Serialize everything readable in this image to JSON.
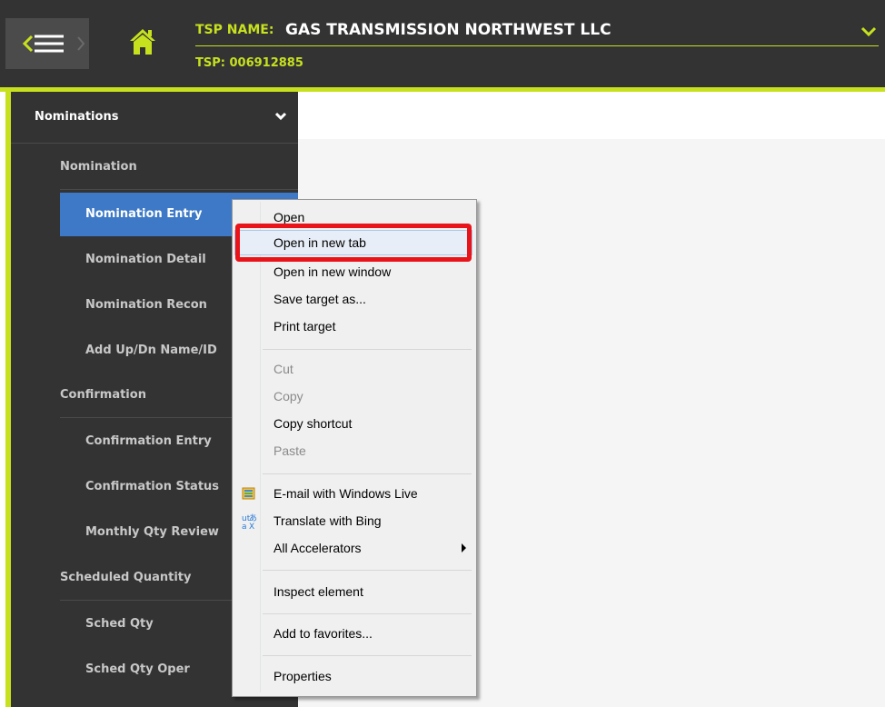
{
  "header": {
    "tsp_name_prefix": "TSP NAME:",
    "tsp_name": "GAS TRANSMISSION NORTHWEST LLC",
    "tsp_id": "TSP: 006912885",
    "accent_color": "#c7e11f",
    "icons": [
      "menu-toggle-icon",
      "home-icon",
      "chevron-down-icon"
    ]
  },
  "sidebar": {
    "group_title": "Nominations",
    "sections": [
      {
        "label": "Nomination",
        "items": [
          "Nomination Entry",
          "Nomination Detail",
          "Nomination Recon",
          "Add Up/Dn Name/ID"
        ]
      },
      {
        "label": "Confirmation",
        "items": [
          "Confirmation Entry",
          "Confirmation Status",
          "Monthly Qty Review"
        ]
      },
      {
        "label": "Scheduled Quantity",
        "items": [
          "Sched Qty",
          "Sched Qty Oper"
        ]
      }
    ],
    "active_item": "Nomination Entry",
    "active_color": "#3d79c6"
  },
  "context_menu": {
    "items": [
      {
        "label": "Open",
        "enabled": true
      },
      {
        "label": "Open in new tab",
        "enabled": true,
        "hovered": true,
        "highlighted": true
      },
      {
        "label": "Open in new window",
        "enabled": true
      },
      {
        "label": "Save target as...",
        "enabled": true
      },
      {
        "label": "Print target",
        "enabled": true
      },
      {
        "label": "Cut",
        "enabled": false
      },
      {
        "label": "Copy",
        "enabled": false
      },
      {
        "label": "Copy shortcut",
        "enabled": true
      },
      {
        "label": "Paste",
        "enabled": false
      },
      {
        "label": "E-mail with Windows Live",
        "enabled": true,
        "icon": "windows-live-mail-icon"
      },
      {
        "label": "Translate with Bing",
        "enabled": true,
        "icon": "bing-translate-icon"
      },
      {
        "label": "All Accelerators",
        "enabled": true,
        "submenu": true
      },
      {
        "label": "Inspect element",
        "enabled": true
      },
      {
        "label": "Add to favorites...",
        "enabled": true
      },
      {
        "label": "Properties",
        "enabled": true
      }
    ],
    "highlight_color": "#e8141a"
  }
}
